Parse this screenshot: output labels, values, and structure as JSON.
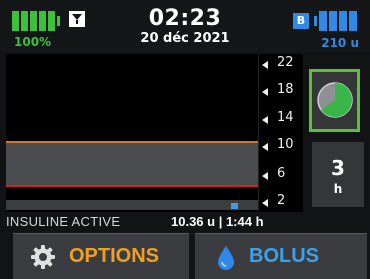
{
  "status": {
    "battery_percent": "100%",
    "battery_level": 1.0,
    "time": "02:23",
    "date": "20 déc 2021",
    "badge": "B",
    "reservoir_units": "210 u",
    "reservoir_level": 1.0,
    "icons": [
      "battery-icon",
      "filter-icon",
      "reservoir-icon"
    ]
  },
  "graph": {
    "y_ticks": [
      "22",
      "18",
      "14",
      "10",
      "6",
      "2"
    ],
    "target_range_colors": {
      "high": "#e26f22",
      "low": "#d81f1f"
    }
  },
  "side_buttons": {
    "active_insulin_pie": "pie-chart-icon",
    "hours_value": "3",
    "hours_unit": "h"
  },
  "insulin_active": {
    "label": "INSULINE ACTIVE",
    "value": "10.36 u | 1:44 h"
  },
  "buttons": {
    "options_label": "OPTIONS",
    "bolus_label": "BOLUS"
  },
  "colors": {
    "green": "#3cc23a",
    "blue": "#2e8ae6",
    "orange": "#f0a020"
  }
}
